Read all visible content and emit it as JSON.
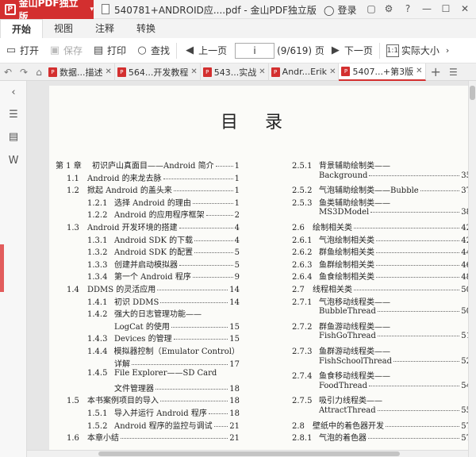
{
  "app": {
    "brand": "金山PDF独立版",
    "doc_title": "540781+ANDROID应....pdf - 金山PDF独立版",
    "login": "登录"
  },
  "menu": [
    "开始",
    "视图",
    "注释",
    "转换"
  ],
  "toolbar": {
    "open": "打开",
    "save": "保存",
    "print": "打印",
    "find": "查找",
    "prev": "上一页",
    "page_value": "i",
    "page_count": "(9/619) 页",
    "next": "下一页",
    "actual_size": "实际大小"
  },
  "doc_tabs": [
    {
      "label": "数据...描述"
    },
    {
      "label": "564...开发教程"
    },
    {
      "label": "543...实战"
    },
    {
      "label": "Andr...Erik"
    },
    {
      "label": "5407...+第3版"
    }
  ],
  "page": {
    "title": "目录",
    "left_col": [
      {
        "num": "第 1 章",
        "text": "初识庐山真面目——Android 简介",
        "pg": "1",
        "level": 0
      },
      {
        "num": "1.1",
        "text": "Android 的来龙去脉",
        "pg": "1",
        "level": 1
      },
      {
        "num": "1.2",
        "text": "掀起 Android 的盖头来",
        "pg": "1",
        "level": 1
      },
      {
        "num": "1.2.1",
        "text": "选择 Android 的理由",
        "pg": "1",
        "level": 2
      },
      {
        "num": "1.2.2",
        "text": "Android 的应用程序框架",
        "pg": "2",
        "level": 2
      },
      {
        "num": "1.3",
        "text": "Android 开发环境的搭建",
        "pg": "4",
        "level": 1
      },
      {
        "num": "1.3.1",
        "text": "Android SDK 的下载",
        "pg": "4",
        "level": 2
      },
      {
        "num": "1.3.2",
        "text": "Android SDK 的配置",
        "pg": "5",
        "level": 2
      },
      {
        "num": "1.3.3",
        "text": "创建并启动模拟器",
        "pg": "5",
        "level": 2
      },
      {
        "num": "1.3.4",
        "text": "第一个 Android 程序",
        "pg": "9",
        "level": 2
      },
      {
        "num": "1.4",
        "text": "DDMS 的灵活应用",
        "pg": "14",
        "level": 1
      },
      {
        "num": "1.4.1",
        "text": "初识 DDMS",
        "pg": "14",
        "level": 2
      },
      {
        "num": "1.4.2",
        "text": "强大的日志管理功能——",
        "pg": "",
        "level": 2
      },
      {
        "num": "",
        "text": "LogCat 的使用",
        "pg": "15",
        "level": 3
      },
      {
        "num": "1.4.3",
        "text": "Devices 的管理",
        "pg": "15",
        "level": 2
      },
      {
        "num": "1.4.4",
        "text": "模拟器控制（Emulator Control）",
        "pg": "",
        "level": 2
      },
      {
        "num": "",
        "text": "详解",
        "pg": "17",
        "level": 3
      },
      {
        "num": "1.4.5",
        "text": "File Explorer——SD Card",
        "pg": "",
        "level": 2
      },
      {
        "num": "",
        "text": "文件管理器",
        "pg": "18",
        "level": 3
      },
      {
        "num": "1.5",
        "text": "本书案例项目的导入",
        "pg": "18",
        "level": 1
      },
      {
        "num": "1.5.1",
        "text": "导入并运行 Android 程序",
        "pg": "18",
        "level": 2
      },
      {
        "num": "1.5.2",
        "text": "Android 程序的监控与调试",
        "pg": "21",
        "level": 2
      },
      {
        "num": "1.6",
        "text": "本章小结",
        "pg": "21",
        "level": 1
      }
    ],
    "right_col": [
      {
        "num": "2.5.1",
        "text": "背景辅助绘制类——",
        "pg": "",
        "level": 2
      },
      {
        "num": "",
        "text": "Background",
        "pg": "35",
        "level": 3
      },
      {
        "num": "2.5.2",
        "text": "气泡辅助绘制类——Bubble",
        "pg": "37",
        "level": 2
      },
      {
        "num": "2.5.3",
        "text": "鱼类辅助绘制类——",
        "pg": "",
        "level": 2
      },
      {
        "num": "",
        "text": "MS3DModel",
        "pg": "38",
        "level": 3
      },
      {
        "num": "2.6",
        "text": "绘制相关类",
        "pg": "42",
        "level": 1
      },
      {
        "num": "2.6.1",
        "text": "气泡绘制相关类",
        "pg": "42",
        "level": 2
      },
      {
        "num": "2.6.2",
        "text": "群鱼绘制相关类",
        "pg": "44",
        "level": 2
      },
      {
        "num": "2.6.3",
        "text": "鱼群绘制相关类",
        "pg": "46",
        "level": 2
      },
      {
        "num": "2.6.4",
        "text": "鱼食绘制相关类",
        "pg": "48",
        "level": 2
      },
      {
        "num": "2.7",
        "text": "线程相关类",
        "pg": "50",
        "level": 1
      },
      {
        "num": "2.7.1",
        "text": "气泡移动线程类——",
        "pg": "",
        "level": 2
      },
      {
        "num": "",
        "text": "BubbleThread",
        "pg": "50",
        "level": 3
      },
      {
        "num": "2.7.2",
        "text": "群鱼游动线程类——",
        "pg": "",
        "level": 2
      },
      {
        "num": "",
        "text": "FishGoThread",
        "pg": "51",
        "level": 3
      },
      {
        "num": "2.7.3",
        "text": "鱼群游动线程类——",
        "pg": "",
        "level": 2
      },
      {
        "num": "",
        "text": "FishSchoolThread",
        "pg": "52",
        "level": 3
      },
      {
        "num": "2.7.4",
        "text": "鱼食移动线程类——",
        "pg": "",
        "level": 2
      },
      {
        "num": "",
        "text": "FoodThread",
        "pg": "54",
        "level": 3
      },
      {
        "num": "2.7.5",
        "text": "吸引力线程类——",
        "pg": "",
        "level": 2
      },
      {
        "num": "",
        "text": "AttractThread",
        "pg": "55",
        "level": 3
      },
      {
        "num": "2.8",
        "text": "壁纸中的着色器开发",
        "pg": "57",
        "level": 1
      },
      {
        "num": "2.8.1",
        "text": "气泡的着色器",
        "pg": "57",
        "level": 2
      }
    ]
  }
}
